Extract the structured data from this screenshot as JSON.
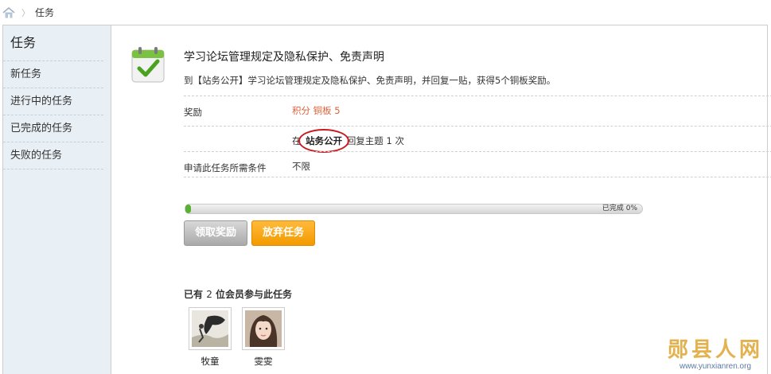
{
  "breadcrumb": {
    "current": "任务"
  },
  "sidebar": {
    "title": "任务",
    "items": [
      {
        "label": "新任务"
      },
      {
        "label": "进行中的任务"
      },
      {
        "label": "已完成的任务"
      },
      {
        "label": "失败的任务"
      }
    ]
  },
  "task": {
    "title": "学习论坛管理规定及隐私保护、免责声明",
    "description": "到【站务公开】学习论坛管理规定及隐私保护、免责声明，并回复一贴，获得5个铜板奖励。",
    "reward_label": "奖励",
    "reward_value": "积分 铜板 5",
    "requirement_prefix": "在",
    "requirement_forum": "站务公开",
    "requirement_suffix": "回复主题 1 次",
    "condition_label": "申请此任务所需条件",
    "condition_value": "不限"
  },
  "progress": {
    "percent": 0,
    "label": "已完成 0%"
  },
  "buttons": {
    "claim": "领取奖励",
    "abandon": "放弃任务"
  },
  "participants": {
    "prefix": "已有",
    "count": "2",
    "suffix": "位会员参与此任务",
    "members": [
      {
        "name": "牧童"
      },
      {
        "name": "雯雯"
      }
    ]
  },
  "watermark": {
    "title": "郧县人网",
    "url": "www.yunxianren.org"
  },
  "colors": {
    "reward": "#d9603b",
    "abandon_button": "#f7a10d",
    "progress_fill": "#5ab032",
    "sidebar_bg": "#e8eff5"
  }
}
